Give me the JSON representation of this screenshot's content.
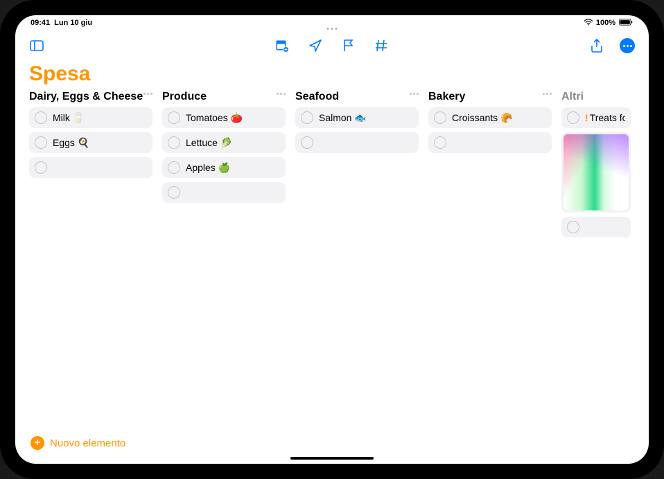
{
  "status": {
    "time": "09:41",
    "date": "Lun 10 giu",
    "battery_text": "100%"
  },
  "list": {
    "title": "Spesa",
    "new_item_label": "Nuovo elemento"
  },
  "columns": [
    {
      "title": "Dairy, Eggs & Cheese",
      "muted": false,
      "show_menu": true,
      "items": [
        {
          "text": "Milk 🥛",
          "priority": false
        },
        {
          "text": "Eggs 🍳",
          "priority": false
        },
        {
          "text": "",
          "priority": false
        }
      ]
    },
    {
      "title": "Produce",
      "muted": false,
      "show_menu": true,
      "items": [
        {
          "text": "Tomatoes 🍅",
          "priority": false
        },
        {
          "text": "Lettuce 🥬",
          "priority": false
        },
        {
          "text": "Apples 🍏",
          "priority": false
        },
        {
          "text": "",
          "priority": false
        }
      ]
    },
    {
      "title": "Seafood",
      "muted": false,
      "show_menu": true,
      "items": [
        {
          "text": "Salmon 🐟",
          "priority": false
        },
        {
          "text": "",
          "priority": false
        }
      ]
    },
    {
      "title": "Bakery",
      "muted": false,
      "show_menu": true,
      "items": [
        {
          "text": "Croissants 🥐",
          "priority": false
        },
        {
          "text": "",
          "priority": false
        }
      ]
    },
    {
      "title": "Altri",
      "muted": true,
      "show_menu": false,
      "partial": true,
      "items": [
        {
          "text": "Treats for t",
          "priority": true
        },
        {
          "type": "image"
        },
        {
          "text": "",
          "priority": false
        }
      ]
    }
  ]
}
